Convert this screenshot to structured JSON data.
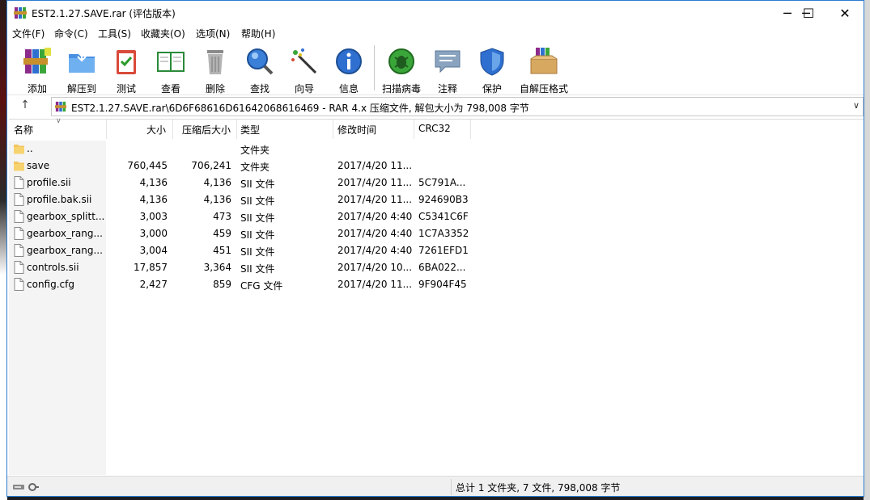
{
  "window": {
    "title": "EST2.1.27.SAVE.rar (评估版本)",
    "minimize": "─",
    "maximize": "☐",
    "close": "✕"
  },
  "menu": [
    "文件(F)",
    "命令(C)",
    "工具(S)",
    "收藏夹(O)",
    "选项(N)",
    "帮助(H)"
  ],
  "toolbar": [
    {
      "label": "添加",
      "icon": "add-archive-icon"
    },
    {
      "label": "解压到",
      "icon": "extract-to-icon"
    },
    {
      "label": "测试",
      "icon": "test-icon"
    },
    {
      "label": "查看",
      "icon": "view-icon"
    },
    {
      "label": "删除",
      "icon": "delete-icon"
    },
    {
      "label": "查找",
      "icon": "find-icon"
    },
    {
      "label": "向导",
      "icon": "wizard-icon"
    },
    {
      "label": "信息",
      "icon": "info-icon"
    },
    {
      "label": "扫描病毒",
      "icon": "virus-scan-icon"
    },
    {
      "label": "注释",
      "icon": "comment-icon"
    },
    {
      "label": "保护",
      "icon": "protect-icon"
    },
    {
      "label": "自解压格式",
      "icon": "sfx-icon"
    }
  ],
  "address": {
    "path": "EST2.1.27.SAVE.rar\\6D6F68616D61642068616469 - RAR 4.x 压缩文件, 解包大小为 798,008 字节"
  },
  "columns": {
    "name": "名称",
    "size": "大小",
    "packed": "压缩后大小",
    "type": "类型",
    "modified": "修改时间",
    "crc": "CRC32"
  },
  "files": [
    {
      "name": "..",
      "size": "",
      "packed": "",
      "type": "文件夹",
      "modified": "",
      "crc": "",
      "kind": "folder"
    },
    {
      "name": "save",
      "size": "760,445",
      "packed": "706,241",
      "type": "文件夹",
      "modified": "2017/4/20 11...",
      "crc": "",
      "kind": "folder"
    },
    {
      "name": "profile.sii",
      "size": "4,136",
      "packed": "4,136",
      "type": "SII 文件",
      "modified": "2017/4/20 11...",
      "crc": "5C791A...",
      "kind": "file"
    },
    {
      "name": "profile.bak.sii",
      "size": "4,136",
      "packed": "4,136",
      "type": "SII 文件",
      "modified": "2017/4/20 11...",
      "crc": "924690B3",
      "kind": "file"
    },
    {
      "name": "gearbox_splitt...",
      "size": "3,003",
      "packed": "473",
      "type": "SII 文件",
      "modified": "2017/4/20 4:40",
      "crc": "C5341C6F",
      "kind": "file"
    },
    {
      "name": "gearbox_rang...",
      "size": "3,000",
      "packed": "459",
      "type": "SII 文件",
      "modified": "2017/4/20 4:40",
      "crc": "1C7A3352",
      "kind": "file"
    },
    {
      "name": "gearbox_rang...",
      "size": "3,004",
      "packed": "451",
      "type": "SII 文件",
      "modified": "2017/4/20 4:40",
      "crc": "7261EFD1",
      "kind": "file"
    },
    {
      "name": "controls.sii",
      "size": "17,857",
      "packed": "3,364",
      "type": "SII 文件",
      "modified": "2017/4/20 10...",
      "crc": "6BA022...",
      "kind": "file"
    },
    {
      "name": "config.cfg",
      "size": "2,427",
      "packed": "859",
      "type": "CFG 文件",
      "modified": "2017/4/20 11...",
      "crc": "9F904F45",
      "kind": "file"
    }
  ],
  "status": {
    "summary": "总计 1 文件夹, 7 文件, 798,008 字节"
  },
  "colors": {
    "window_border": "#2b7bd0",
    "folder": "#f2c55c"
  }
}
